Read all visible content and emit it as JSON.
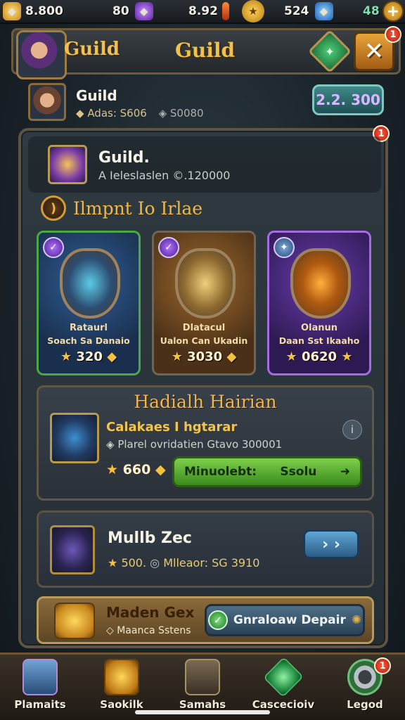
{
  "resources": [
    {
      "icon": "gold-coin-icon",
      "value": "8.800"
    },
    {
      "icon": "purple-gem-icon",
      "value": "80"
    },
    {
      "icon": "fire-icon",
      "value": "8.92"
    },
    {
      "icon": "star-badge-icon",
      "value": ""
    },
    {
      "icon": "blue-gem-icon",
      "value": "524"
    },
    {
      "icon": "green-gem-icon",
      "value": "48"
    }
  ],
  "header": {
    "left_title": "Guild",
    "center_title": "Guild",
    "close_badge": "1"
  },
  "profile": {
    "name": "Guild",
    "stat1": "Adas: S606",
    "stat2": "S0080",
    "score": "2.2. 300"
  },
  "panel": {
    "badge": "1",
    "guild_title": "Guild.",
    "guild_sub": "A Ieleslaslen ©.120000",
    "section_title": "Ilmpnt Io Irlae"
  },
  "cards": [
    {
      "line1": "Rataurl",
      "line2": "Soach Sa Danaio",
      "price": "320",
      "color": "#4aa84a",
      "bg": "#1f3c64"
    },
    {
      "line1": "Dlatacul",
      "line2": "Ualon Can Ukadin",
      "price": "3030",
      "color": "#6f6456",
      "bg": "#5a3c1e"
    },
    {
      "line1": "Olanun",
      "line2": "Daan Sst Ikaaho",
      "price": "0620",
      "color": "#a56be0",
      "bg": "#3c2266"
    }
  ],
  "featured": {
    "title": "Hadialh Hairian",
    "name": "Calakaes I hgtarar",
    "desc": "Plarel ovridatien Gtavo 300001",
    "price": "660",
    "button_label": "Minuolebt:",
    "button_label2": "Ssolu"
  },
  "item": {
    "name": "Mullb Zec",
    "stat1": "500.",
    "stat2": "Mlleaor: SG 3910"
  },
  "offer": {
    "title": "Maden Gex",
    "sub": "Maanca Sstens",
    "button_label": "Gnraloaw Depair"
  },
  "nav": [
    {
      "icon": "planets-icon",
      "label": "Plamaits"
    },
    {
      "icon": "treasure-chest-icon",
      "label": "Saokilk"
    },
    {
      "icon": "shield-icon",
      "label": "Samahs"
    },
    {
      "icon": "emerald-icon",
      "label": "Cascecioiv"
    },
    {
      "icon": "gear-icon",
      "label": "Legod",
      "badge": "1"
    }
  ]
}
